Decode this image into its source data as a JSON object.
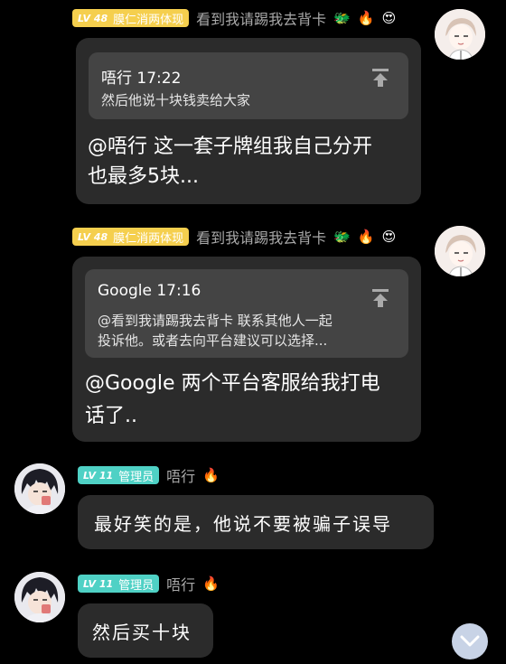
{
  "messages": [
    {
      "level": "LV 48",
      "title": "膜仁消两体现",
      "sender": "看到我请踢我去背卡",
      "emojis": [
        "🐲",
        "🔥",
        "😍"
      ],
      "quote": {
        "author_time": "唔行 17:22",
        "text": "然后他说十块钱卖给大家"
      },
      "text_line1": "@唔行 这一套子牌组我自己分开",
      "text_line2": "也最多5块..."
    },
    {
      "level": "LV 48",
      "title": "膜仁消两体现",
      "sender": "看到我请踢我去背卡",
      "emojis": [
        "🐲",
        "🔥",
        "😍"
      ],
      "quote": {
        "author_time": "Google 17:16",
        "text_line1": "@看到我请踢我去背卡 联系其他人一起",
        "text_line2": "投诉他。或者去向平台建议可以选择..."
      },
      "text_line1": "@Google 两个平台客服给我打电",
      "text_line2": "话了.."
    },
    {
      "level": "LV 11",
      "title": "管理员",
      "sender": "唔行",
      "emojis": [
        "🔥"
      ],
      "text": "最好笑的是，他说不要被骗子误导"
    },
    {
      "level": "LV 11",
      "title": "管理员",
      "sender": "唔行",
      "emojis": [
        "🔥"
      ],
      "text": "然后买十块"
    }
  ],
  "scroll_button": {
    "icon": "chevron-down-icon"
  },
  "colors": {
    "background": "#000000",
    "bubble": "#2b2b2b",
    "quote": "#444444",
    "gold_badge": "#f5cf4e",
    "teal_badge": "#4fd1c5"
  }
}
